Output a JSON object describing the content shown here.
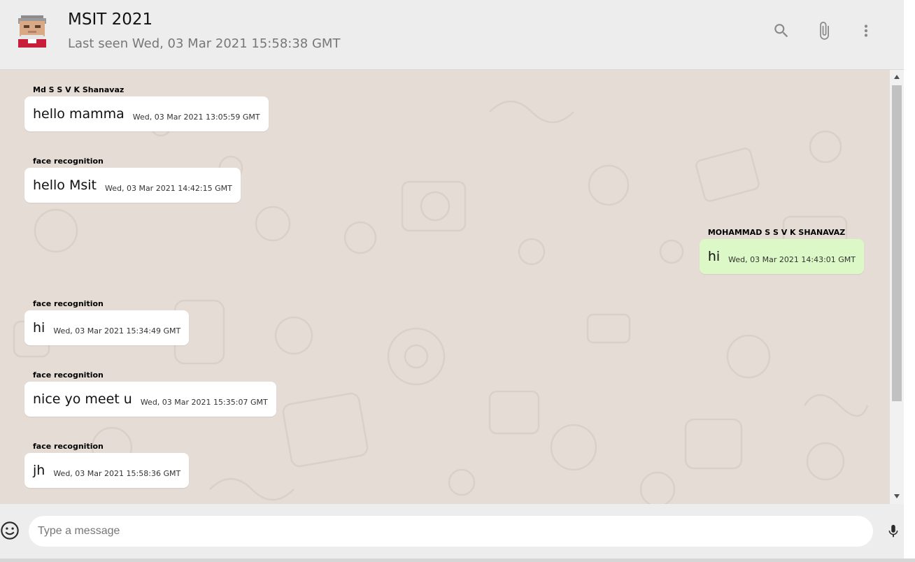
{
  "header": {
    "title": "MSIT 2021",
    "status": "Last seen Wed, 03 Mar 2021 15:58:38 GMT",
    "avatar_icon": "pixel-avatar-icon",
    "actions": [
      "search-icon",
      "attach-icon",
      "more-vert-icon"
    ]
  },
  "messages": [
    {
      "sender": "Md S S V K Shanavaz",
      "text": "hello mamma",
      "time": "Wed, 03 Mar 2021 13:05:59 GMT",
      "mine": false
    },
    {
      "sender": "face recognition",
      "text": "hello Msit",
      "time": "Wed, 03 Mar 2021 14:42:15 GMT",
      "mine": false
    },
    {
      "sender": "MOHAMMAD S S V K SHANAVAZ",
      "text": "hi",
      "time": "Wed, 03 Mar 2021 14:43:01 GMT",
      "mine": true
    },
    {
      "sender": "face recognition",
      "text": "hi",
      "time": "Wed, 03 Mar 2021 15:34:49 GMT",
      "mine": false
    },
    {
      "sender": "face recognition",
      "text": "nice yo meet u",
      "time": "Wed, 03 Mar 2021 15:35:07 GMT",
      "mine": false
    },
    {
      "sender": "face recognition",
      "text": "jh",
      "time": "Wed, 03 Mar 2021 15:58:36 GMT",
      "mine": false
    }
  ],
  "composer": {
    "placeholder": "Type a message",
    "value": ""
  },
  "colors": {
    "chat_bg": "#e5ddd5",
    "incoming_bubble": "#ffffff",
    "outgoing_bubble": "#dcf8c6",
    "header_bg": "#ededed"
  }
}
